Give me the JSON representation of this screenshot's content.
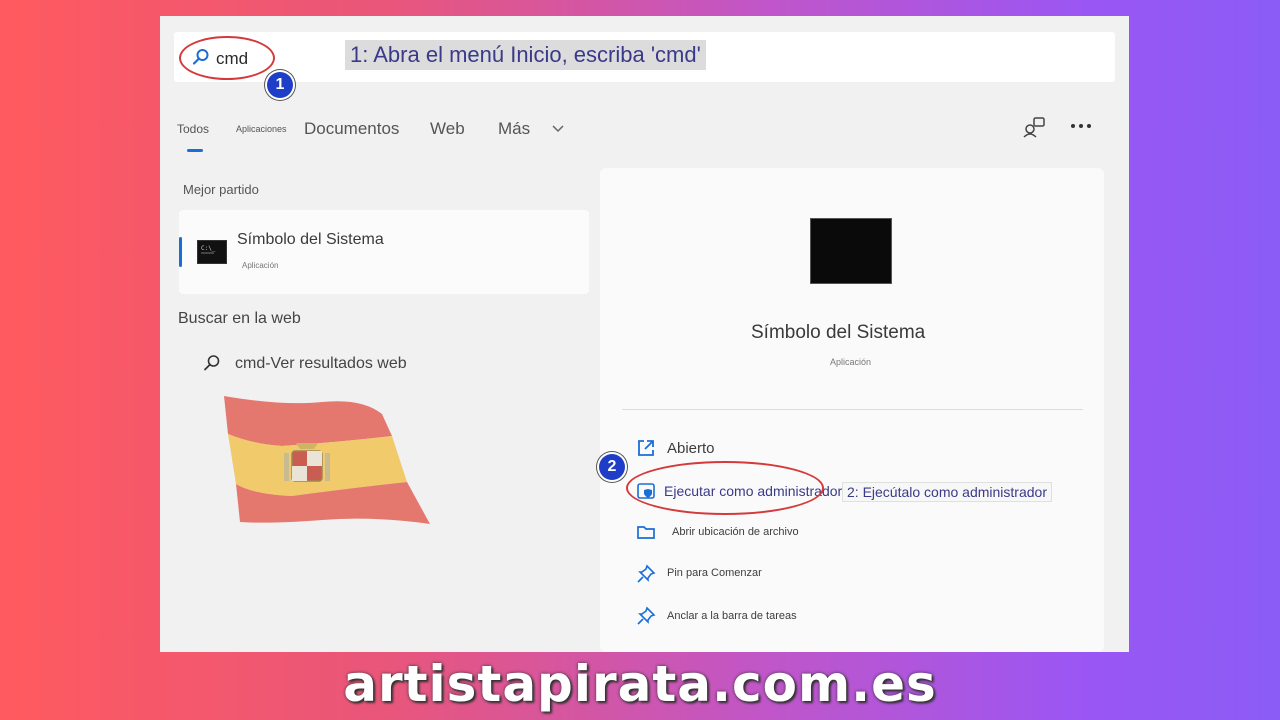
{
  "search": {
    "query": "cmd"
  },
  "annotations": {
    "step1_badge": "1",
    "step1_text": "1: Abra el menú Inicio, escriba 'cmd'",
    "step2_badge": "2",
    "step2_text": "2: Ejecútalo como administrador"
  },
  "tabs": [
    "Todos",
    "Aplicaciones",
    "Documentos",
    "Web",
    "Más"
  ],
  "left": {
    "best_match_label": "Mejor partido",
    "best_match": {
      "title": "Símbolo del Sistema",
      "subtitle": "Aplicación"
    },
    "web_label": "Buscar en la web",
    "web_result": "cmd-Ver resultados web"
  },
  "detail": {
    "title": "Símbolo del Sistema",
    "subtitle": "Aplicación",
    "actions": [
      {
        "label": "Abierto",
        "icon": "open-external-icon"
      },
      {
        "label": "Ejecutar como administrador)",
        "icon": "shield-icon"
      },
      {
        "label": "Abrir ubicación de archivo",
        "icon": "folder-icon"
      },
      {
        "label": "Pin para Comenzar",
        "icon": "pin-icon"
      },
      {
        "label": "Anclar a la barra de tareas",
        "icon": "pin-icon"
      }
    ]
  },
  "footer": {
    "site": "artistapirata.com.es"
  },
  "colors": {
    "accent": "#1a6ed8",
    "badge": "#1e3ec8",
    "ring": "#d43a3a",
    "instruction_text": "#3a3a8a"
  }
}
